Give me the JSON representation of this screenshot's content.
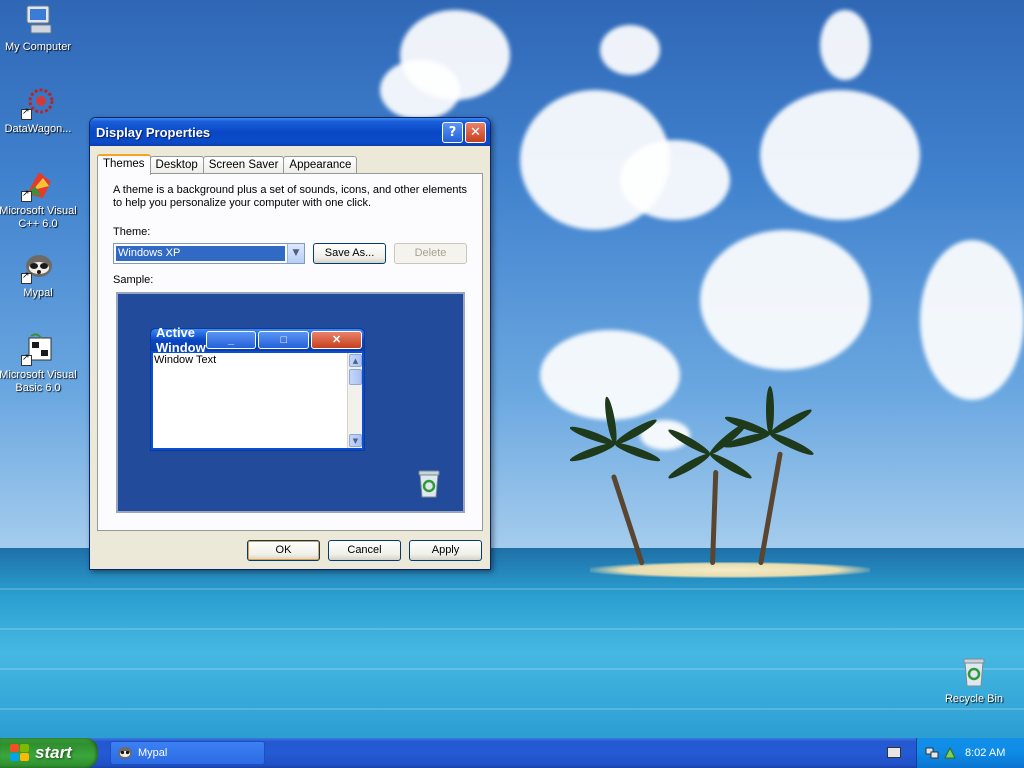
{
  "desktop": {
    "icons": [
      {
        "name": "my-computer",
        "label": "My Computer"
      },
      {
        "name": "datawagon",
        "label": "DataWagon..."
      },
      {
        "name": "ms-visual-cpp",
        "label": "Microsoft Visual C++ 6.0"
      },
      {
        "name": "mypal",
        "label": "Mypal"
      },
      {
        "name": "ms-visual-basic",
        "label": "Microsoft Visual Basic 6.0"
      },
      {
        "name": "recycle-bin",
        "label": "Recycle Bin"
      }
    ]
  },
  "dialog": {
    "title": "Display Properties",
    "help_label": "?",
    "close_label": "✕",
    "tabs": [
      {
        "label": "Themes",
        "active": true
      },
      {
        "label": "Desktop"
      },
      {
        "label": "Screen Saver"
      },
      {
        "label": "Appearance"
      }
    ],
    "description": "A theme is a background plus a set of sounds, icons, and other elements to help you personalize your computer with one click.",
    "theme_label": "Theme:",
    "theme_value": "Windows XP",
    "save_as_label": "Save As...",
    "delete_label": "Delete",
    "sample_label": "Sample:",
    "sample_window": {
      "title": "Active Window",
      "body_text": "Window Text"
    },
    "ok_label": "OK",
    "cancel_label": "Cancel",
    "apply_label": "Apply"
  },
  "taskbar": {
    "start_label": "start",
    "items": [
      {
        "label": "Mypal"
      }
    ],
    "clock": "8:02 AM"
  },
  "colors": {
    "titlebar": "#0a48c6",
    "dialog_bg": "#ece9d8",
    "selection": "#316ac5",
    "taskbar": "#245ad4",
    "start_button": "#3ba63b"
  }
}
